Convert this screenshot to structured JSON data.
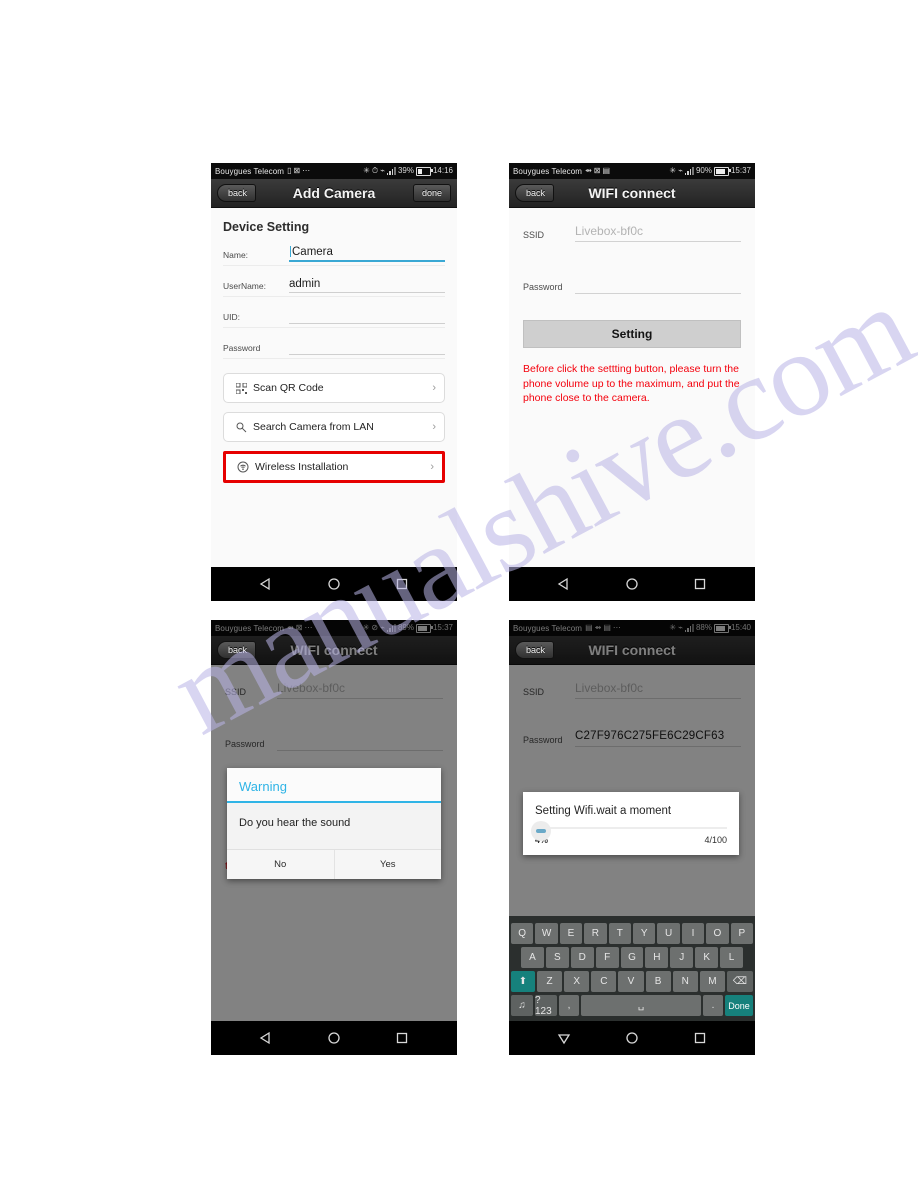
{
  "watermark": {
    "text": "manualshive.com"
  },
  "screens": [
    {
      "id": "add-camera",
      "status": {
        "carrier": "Bouygues Telecom",
        "battery": "39%",
        "time": "14:16"
      },
      "titlebar": {
        "back": "back",
        "title": "Add Camera",
        "done": "done"
      },
      "section_title": "Device Setting",
      "fields": [
        {
          "label": "Name:",
          "value": "Camera"
        },
        {
          "label": "UserName:",
          "value": "admin"
        },
        {
          "label": "UID:",
          "value": ""
        },
        {
          "label": "Password",
          "value": ""
        }
      ],
      "rows": [
        {
          "icon": "qr-code-icon",
          "label": "Scan QR Code",
          "chevron": "›"
        },
        {
          "icon": "search-icon",
          "label": "Search Camera from LAN",
          "chevron": "›"
        },
        {
          "icon": "wireless-icon",
          "label": "Wireless Installation",
          "chevron": "›"
        }
      ],
      "highlight_color": "#e60000"
    },
    {
      "id": "wifi-connect",
      "status": {
        "carrier": "Bouygues Telecom",
        "battery": "90%",
        "time": "15:37"
      },
      "titlebar": {
        "back": "back",
        "title": "WIFI connect"
      },
      "fields": [
        {
          "label": "SSID",
          "value": "Livebox-bf0c"
        },
        {
          "label": "Password",
          "value": ""
        }
      ],
      "setting_button": "Setting",
      "warning_text": "Before click the settting button, please turn the phone volume up to the maximum, and put the phone close to the camera.",
      "warning_color": "#f4000c"
    },
    {
      "id": "wifi-connect-warning",
      "status": {
        "carrier": "Bouygues Telecom",
        "battery": "89%",
        "time": "15:37"
      },
      "titlebar": {
        "back": "back",
        "title": "WIFI connect"
      },
      "fields": [
        {
          "label": "SSID",
          "value": "Livebox-bf0c"
        },
        {
          "label": "Password",
          "value": ""
        }
      ],
      "warning_text_tail": "the camera.",
      "dialog": {
        "title": "Warning",
        "message": "Do you hear the sound",
        "no": "No",
        "yes": "Yes",
        "accent": "#2fb4e6"
      }
    },
    {
      "id": "wifi-connect-progress",
      "status": {
        "carrier": "Bouygues Telecom",
        "battery": "88%",
        "time": "15:40"
      },
      "titlebar": {
        "back": "back",
        "title": "WIFI connect"
      },
      "fields": [
        {
          "label": "SSID",
          "value": "Livebox-bf0c"
        },
        {
          "label": "Password",
          "value": "C27F976C275FE6C29CF63"
        }
      ],
      "progress": {
        "title": "Setting Wifi.wait a moment",
        "percent": "4%",
        "count": "4/100",
        "value": 4
      },
      "keyboard": {
        "row1": [
          "Q",
          "W",
          "E",
          "R",
          "T",
          "Y",
          "U",
          "I",
          "O",
          "P"
        ],
        "row2": [
          "A",
          "S",
          "D",
          "F",
          "G",
          "H",
          "J",
          "K",
          "L"
        ],
        "row3": [
          "Z",
          "X",
          "C",
          "V",
          "B",
          "N",
          "M"
        ],
        "shift": "⬆",
        "backspace": "⌫",
        "emoji": "♫",
        "numbers": "?123",
        "comma": ",",
        "space": "",
        "period": ".",
        "done": "Done"
      }
    }
  ],
  "navbar": {
    "back": "back-triangle-icon",
    "home": "home-circle-icon",
    "recents": "recents-square-icon"
  }
}
